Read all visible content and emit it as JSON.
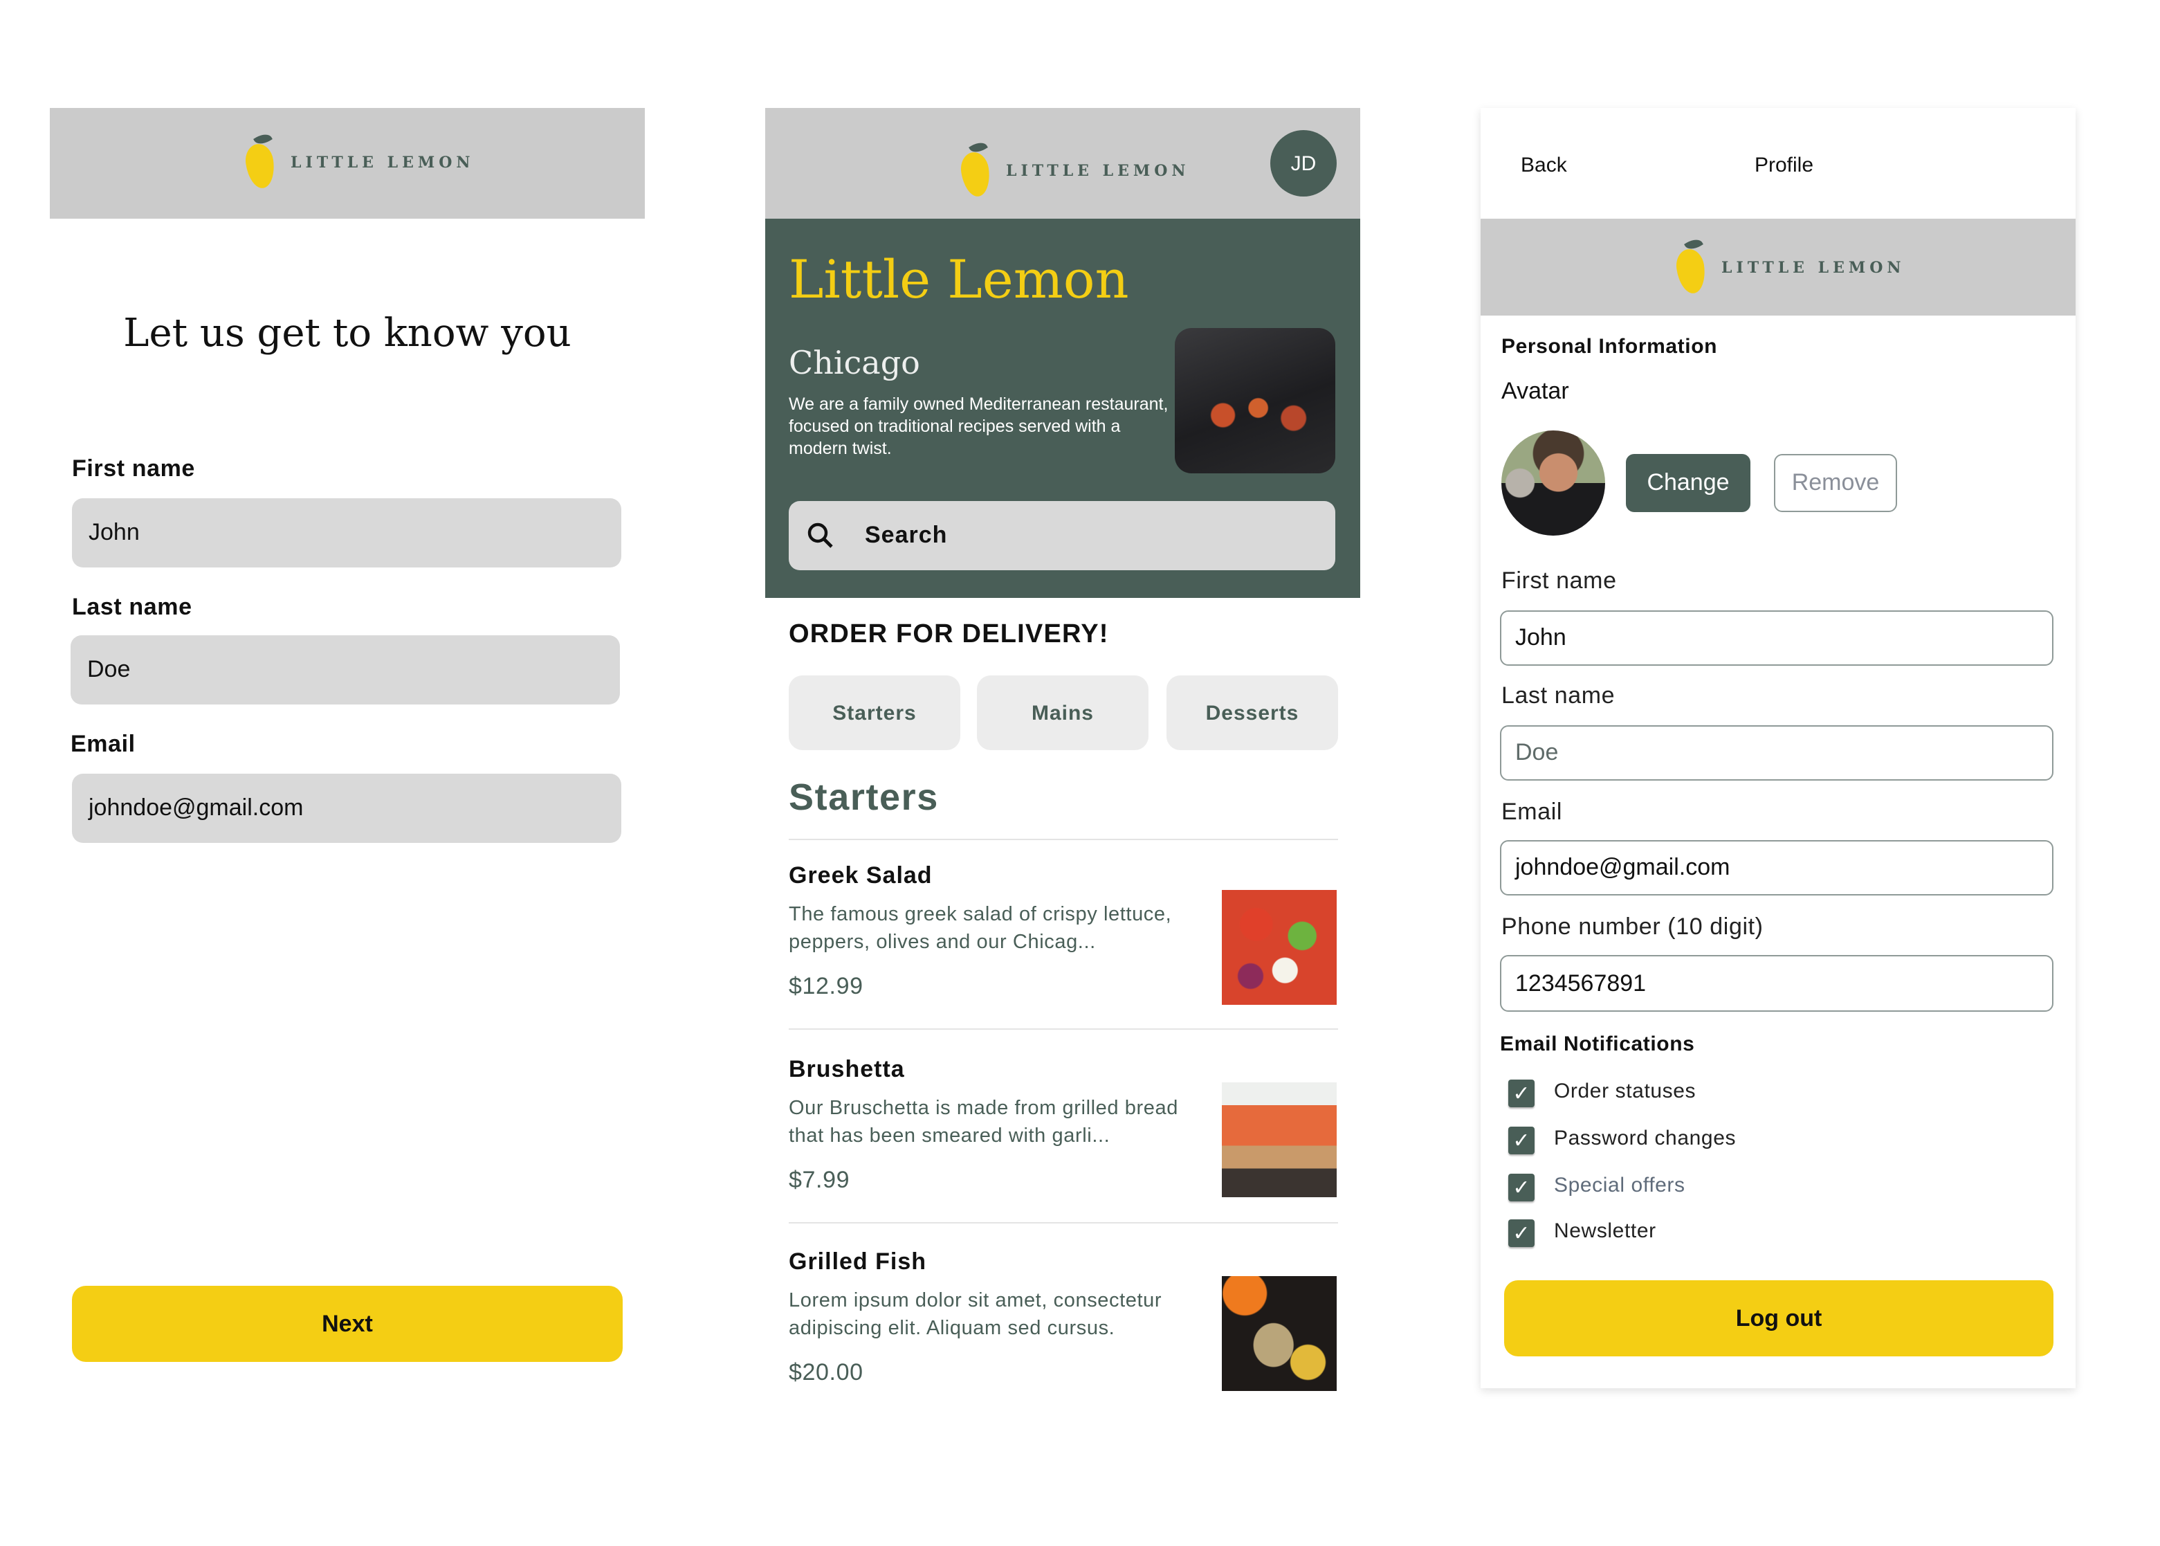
{
  "brand": {
    "wordmark": "LITTLE LEMON",
    "primary": "#495e57",
    "accent": "#f4ce14",
    "header_bg": "#cbcbcb"
  },
  "onboarding": {
    "title": "Let us get to know you",
    "fields": [
      {
        "label": "First name",
        "value": "John"
      },
      {
        "label": "Last name",
        "value": "Doe"
      },
      {
        "label": "Email",
        "value": "johndoe@gmail.com"
      }
    ],
    "next_label": "Next"
  },
  "home": {
    "avatar_initials": "JD",
    "hero": {
      "title": "Little Lemon",
      "city": "Chicago",
      "description": "We are a family owned Mediterranean restaurant, focused on traditional recipes served with a modern twist."
    },
    "search": {
      "placeholder": "Search",
      "icon": "search-icon"
    },
    "order_heading": "ORDER FOR DELIVERY!",
    "categories": [
      "Starters",
      "Mains",
      "Desserts"
    ],
    "section_title": "Starters",
    "menu": [
      {
        "name": "Greek Salad",
        "description": "The famous greek salad of crispy lettuce, peppers, olives and our Chicag...",
        "price": "$12.99"
      },
      {
        "name": "Brushetta",
        "description": "Our Bruschetta is made from grilled bread that has been smeared with garli...",
        "price": "$7.99"
      },
      {
        "name": "Grilled Fish",
        "description": "Lorem ipsum dolor sit amet, consectetur adipiscing elit. Aliquam sed cursus.",
        "price": "$20.00"
      }
    ]
  },
  "profile": {
    "nav": {
      "back": "Back",
      "title": "Profile"
    },
    "section_title": "Personal Information",
    "avatar_label": "Avatar",
    "change_label": "Change",
    "remove_label": "Remove",
    "fields": [
      {
        "label": "First name",
        "value": "John"
      },
      {
        "label": "Last name",
        "value": "Doe"
      },
      {
        "label": "Email",
        "value": "johndoe@gmail.com"
      },
      {
        "label": "Phone number (10 digit)",
        "value": "1234567891"
      }
    ],
    "notifications_title": "Email Notifications",
    "notifications": [
      {
        "label": "Order statuses",
        "checked": true
      },
      {
        "label": "Password changes",
        "checked": true
      },
      {
        "label": "Special offers",
        "checked": true
      },
      {
        "label": "Newsletter",
        "checked": true
      }
    ],
    "logout_label": "Log out"
  }
}
